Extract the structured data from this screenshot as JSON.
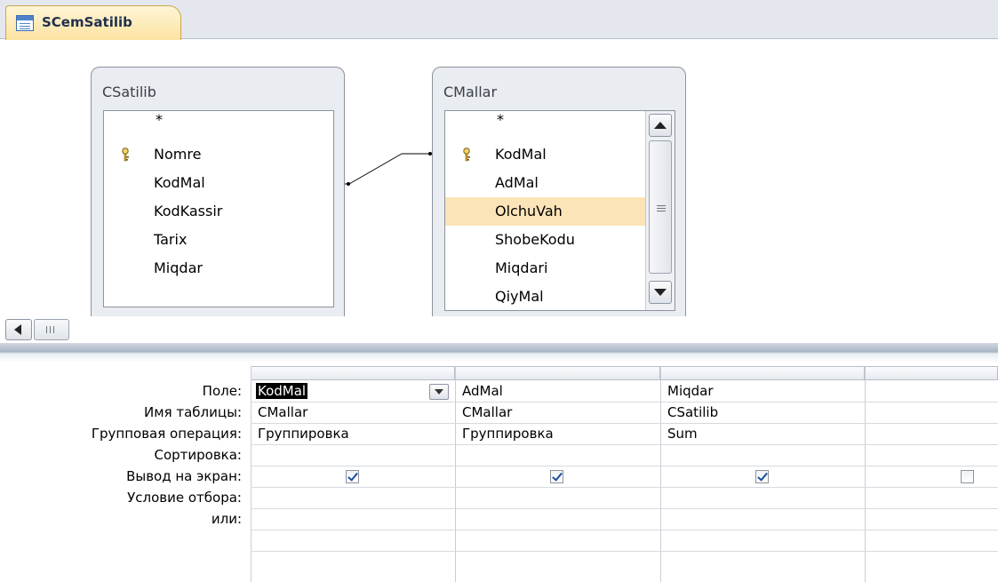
{
  "tab": {
    "label": "SCemSatilib",
    "icon": "query-icon"
  },
  "tables": [
    {
      "title": "CSatilib",
      "fields": [
        "*",
        "Nomre",
        "KodMal",
        "KodKassir",
        "Tarix",
        "Miqdar"
      ],
      "key_field": "Nomre"
    },
    {
      "title": "CMallar",
      "fields": [
        "*",
        "KodMal",
        "AdMal",
        "OlchuVah",
        "ShobeKodu",
        "Miqdari",
        "QiyMal"
      ],
      "key_field": "KodMal",
      "selected_field": "OlchuVah"
    }
  ],
  "grid": {
    "row_labels": {
      "field": "Поле:",
      "table": "Имя таблицы:",
      "total": "Групповая операция:",
      "sort": "Сортировка:",
      "show": "Вывод на экран:",
      "criteria": "Условие отбора:",
      "or": "или:"
    },
    "columns": [
      {
        "field": "KodMal",
        "table": "CMallar",
        "total": "Группировка",
        "sort": "",
        "show": true
      },
      {
        "field": "AdMal",
        "table": "CMallar",
        "total": "Группировка",
        "sort": "",
        "show": true
      },
      {
        "field": "Miqdar",
        "table": "CSatilib",
        "total": "Sum",
        "sort": "",
        "show": true
      },
      {
        "field": "",
        "table": "",
        "total": "",
        "sort": "",
        "show": false
      }
    ]
  },
  "colors": {
    "selected_row": "#fbe4b8",
    "tab_active": "#fbe3a1"
  }
}
